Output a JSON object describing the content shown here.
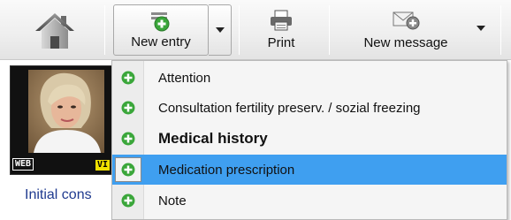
{
  "toolbar": {
    "home_icon": "home-icon",
    "new_entry_label": "New entry",
    "print_label": "Print",
    "new_message_label": "New message"
  },
  "patient": {
    "badge_web": "WEB",
    "badge_vip": "VI",
    "initial_link": "Initial cons"
  },
  "dropdown": {
    "items": [
      {
        "label": "Attention",
        "icon": "plus-circle-icon",
        "bold": false,
        "selected": false
      },
      {
        "label": "Consultation fertility preserv. / sozial freezing",
        "icon": "plus-circle-icon",
        "bold": false,
        "selected": false
      },
      {
        "label": "Medical history",
        "icon": "plus-circle-icon",
        "bold": true,
        "selected": false
      },
      {
        "label": "Medication prescription",
        "icon": "plus-circle-icon",
        "bold": false,
        "selected": true
      },
      {
        "label": "Note",
        "icon": "plus-circle-icon",
        "bold": false,
        "selected": false
      }
    ]
  },
  "colors": {
    "selection": "#3f9ff0",
    "plus_green": "#3aa63a",
    "link": "#1f3a8f"
  }
}
